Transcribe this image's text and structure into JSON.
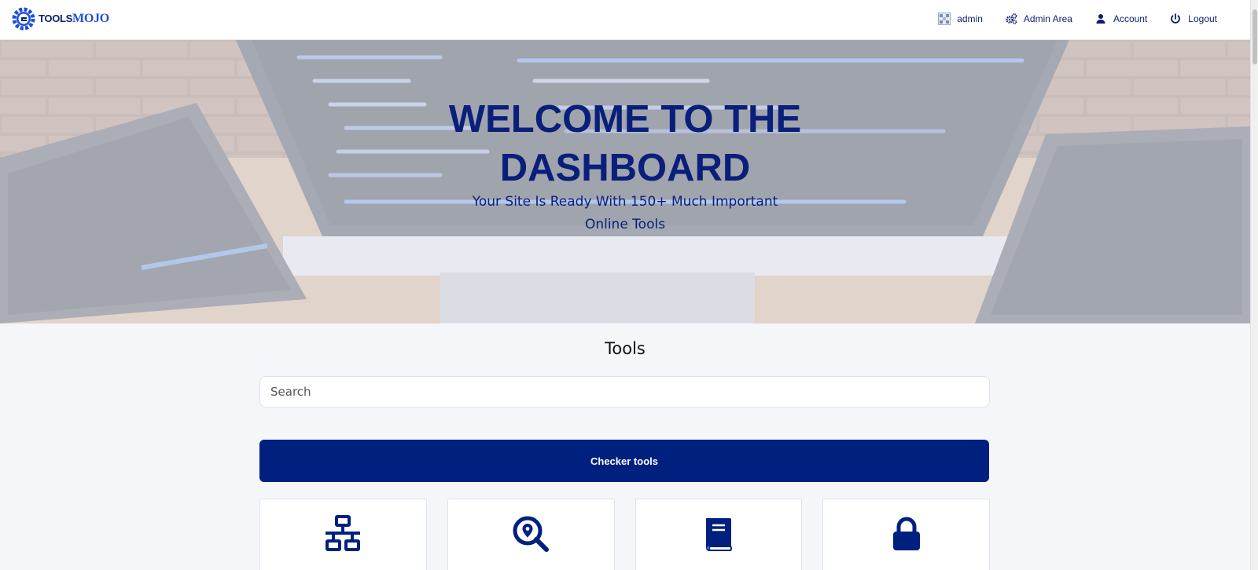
{
  "brand": {
    "logo_tools": "TOOLS",
    "logo_mojo": "MOJO"
  },
  "nav": {
    "items": [
      {
        "label": "admin",
        "icon": "user-avatar-icon"
      },
      {
        "label": "Admin Area",
        "icon": "gears-icon"
      },
      {
        "label": "Account",
        "icon": "user-icon"
      },
      {
        "label": "Logout",
        "icon": "power-icon"
      }
    ]
  },
  "hero": {
    "title_line1": "WELCOME TO THE",
    "title_line2": "DASHBOARD",
    "subtitle_line1": "Your Site Is Ready With 150+ Much Important",
    "subtitle_line2": "Online Tools"
  },
  "tools": {
    "heading": "Tools",
    "search_placeholder": "Search",
    "category_label": "Checker tools",
    "cards": [
      {
        "icon": "network-icon"
      },
      {
        "icon": "location-search-icon"
      },
      {
        "icon": "book-icon"
      },
      {
        "icon": "lock-icon"
      }
    ]
  },
  "colors": {
    "primary": "#00207f",
    "accent": "#1e4fd8",
    "background": "#f4f6f9"
  }
}
